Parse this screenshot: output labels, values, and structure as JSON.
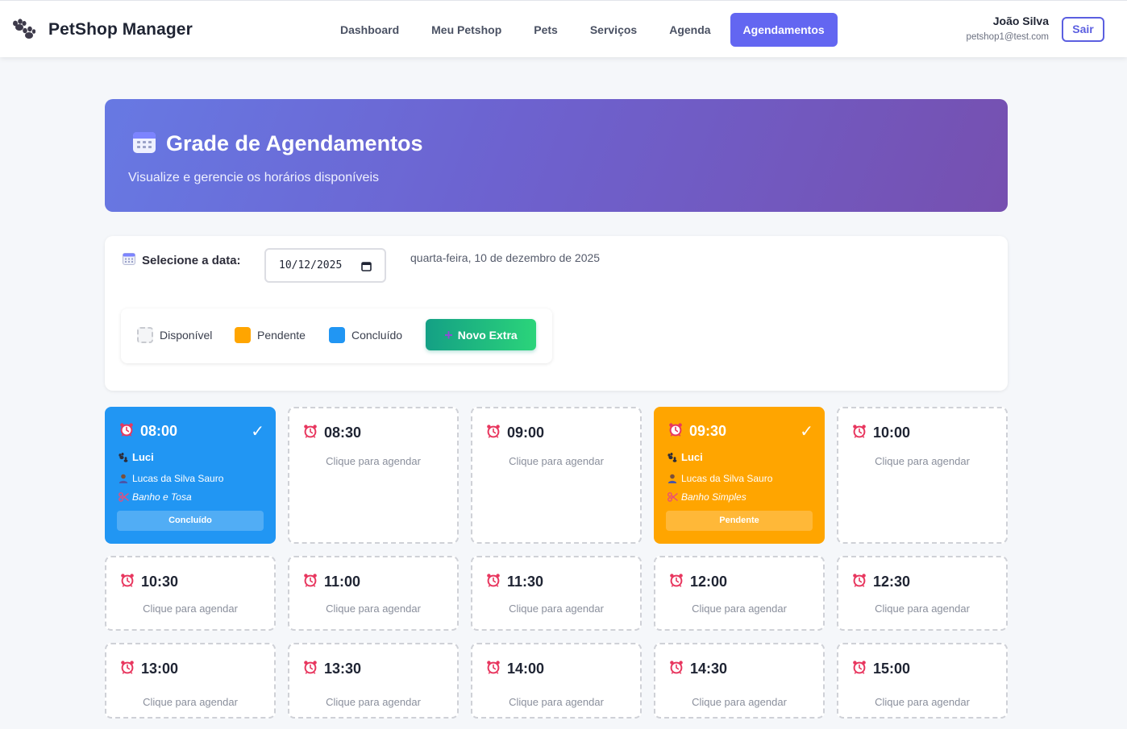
{
  "navbar": {
    "brand": "PetShop Manager",
    "links": [
      {
        "label": "Dashboard"
      },
      {
        "label": "Meu Petshop"
      },
      {
        "label": "Pets"
      },
      {
        "label": "Serviços"
      },
      {
        "label": "Agenda"
      },
      {
        "label": "Agendamentos",
        "active": true
      }
    ],
    "user_name": "João Silva",
    "user_email": "petshop1@test.com",
    "logout_label": "Sair"
  },
  "hero": {
    "title": "Grade de Agendamentos",
    "subtitle": "Visualize e gerencie os horários disponíveis"
  },
  "filter": {
    "date_label": "Selecione a data:",
    "date_value": "10/12/2025",
    "date_long": "quarta-feira, 10 de dezembro de 2025"
  },
  "legend": {
    "available": "Disponível",
    "pending": "Pendente",
    "done": "Concluído",
    "extra_button": "Novo Extra"
  },
  "colors": {
    "accent": "#6366f1",
    "done": "#2196f3",
    "pending": "#ffa500",
    "extra_button": "#22c07a"
  },
  "slot_hint": "Clique para agendar",
  "slots": [
    {
      "time": "08:00",
      "status": "done",
      "pet": "Luci",
      "owner": "Lucas da Silva Sauro",
      "service": "Banho e Tosa",
      "status_label": "Concluído"
    },
    {
      "time": "08:30",
      "status": "free"
    },
    {
      "time": "09:00",
      "status": "free"
    },
    {
      "time": "09:30",
      "status": "pending",
      "pet": "Luci",
      "owner": "Lucas da Silva Sauro",
      "service": "Banho Simples",
      "status_label": "Pendente"
    },
    {
      "time": "10:00",
      "status": "free"
    },
    {
      "time": "10:30",
      "status": "free"
    },
    {
      "time": "11:00",
      "status": "free"
    },
    {
      "time": "11:30",
      "status": "free"
    },
    {
      "time": "12:00",
      "status": "free"
    },
    {
      "time": "12:30",
      "status": "free"
    },
    {
      "time": "13:00",
      "status": "free"
    },
    {
      "time": "13:30",
      "status": "free"
    },
    {
      "time": "14:00",
      "status": "free"
    },
    {
      "time": "14:30",
      "status": "free"
    },
    {
      "time": "15:00",
      "status": "free"
    }
  ]
}
